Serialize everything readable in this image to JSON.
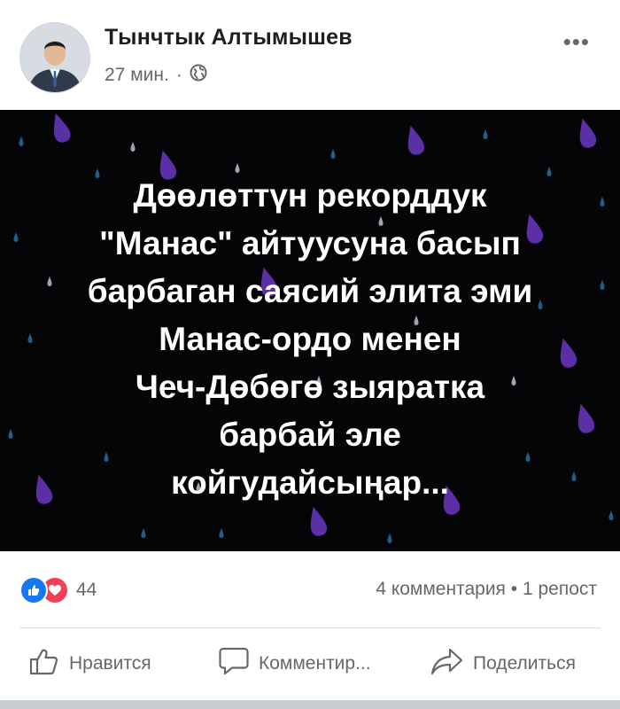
{
  "post": {
    "author": "Тынчтык Алтымышев",
    "time": "27 мин.",
    "separator": "·",
    "more": "•••",
    "image_text": [
      "Дөөлөттүн рекорддук",
      "\"Манас\" айтуусуна басып",
      "барбаган саясий элита эми",
      "Манас-ордо менен",
      "Чеч-Дөбөгө зыяратка",
      "барбай эле",
      "койгудайсыңар..."
    ]
  },
  "stats": {
    "reactions_count": "44",
    "comments_shares": "4 комментария • 1 репост"
  },
  "actions": {
    "like": "Нравится",
    "comment": "Комментир...",
    "share": "Поделиться"
  },
  "icons": [
    "globe-icon",
    "more-icon",
    "like-icon",
    "love-icon",
    "comment-icon",
    "share-icon"
  ],
  "colors": {
    "like_blue": "#1877f2",
    "love_red": "#f33e58",
    "drop_purple": "#5b2fa6",
    "image_bg": "#050507"
  }
}
